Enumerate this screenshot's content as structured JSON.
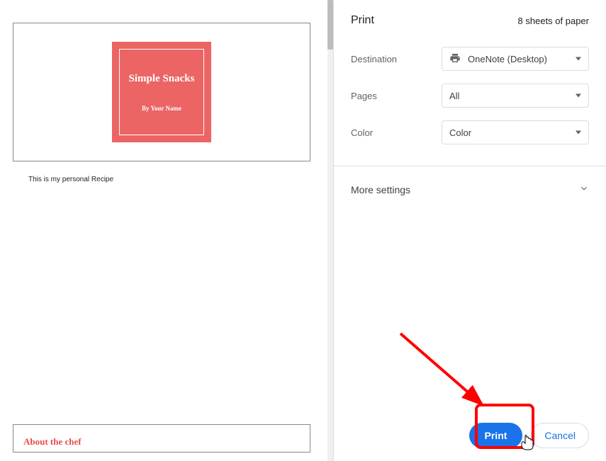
{
  "preview": {
    "book_title": "Simple Snacks",
    "book_author": "By Your Name",
    "caption": "This is my personal Recipe",
    "page2_heading": "About the chef"
  },
  "header": {
    "title": "Print",
    "sheet_count": "8 sheets of paper"
  },
  "settings": {
    "destination_label": "Destination",
    "destination_value": "OneNote (Desktop)",
    "pages_label": "Pages",
    "pages_value": "All",
    "color_label": "Color",
    "color_value": "Color",
    "more_settings": "More settings"
  },
  "footer": {
    "print": "Print",
    "cancel": "Cancel"
  }
}
